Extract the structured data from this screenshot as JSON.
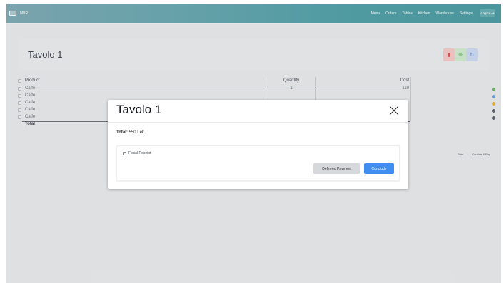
{
  "navbar": {
    "brand": "MBR",
    "links": [
      "Menu",
      "Orders",
      "Tables",
      "Kitchen",
      "Warehouse",
      "Settings"
    ],
    "logout_label": "Logout"
  },
  "page": {
    "title": "Tavolo 1"
  },
  "table": {
    "headers": {
      "product": "Product",
      "quantity": "Quantity",
      "cost": "Cost"
    },
    "rows": [
      {
        "product": "Caffe",
        "quantity": "1",
        "cost": "110",
        "status_color": "#6db36a"
      },
      {
        "product": "Caffe",
        "quantity": "",
        "cost": "",
        "status_color": "#6f9fd8"
      },
      {
        "product": "Caffe",
        "quantity": "",
        "cost": "",
        "status_color": "#e8b43a"
      },
      {
        "product": "Caffe",
        "quantity": "",
        "cost": "",
        "status_color": "#5d6670"
      },
      {
        "product": "Caffe",
        "quantity": "",
        "cost": "",
        "status_color": "#5d6670"
      }
    ],
    "total_label": "Total"
  },
  "side_actions": {
    "print": "Print",
    "confirm_pay": "Confirm & Pay"
  },
  "modal": {
    "title": "Tavolo 1",
    "total_label": "Total:",
    "total_value": "550 Lek",
    "fiscal_receipt_label": "Fiscal Receipt",
    "deferred_label": "Deferred Payment",
    "conclude_label": "Conclude"
  },
  "colors": {
    "conclude_button": "#3f8ef0",
    "navbar_start": "#7aa3ad",
    "navbar_end": "#4a969c"
  }
}
